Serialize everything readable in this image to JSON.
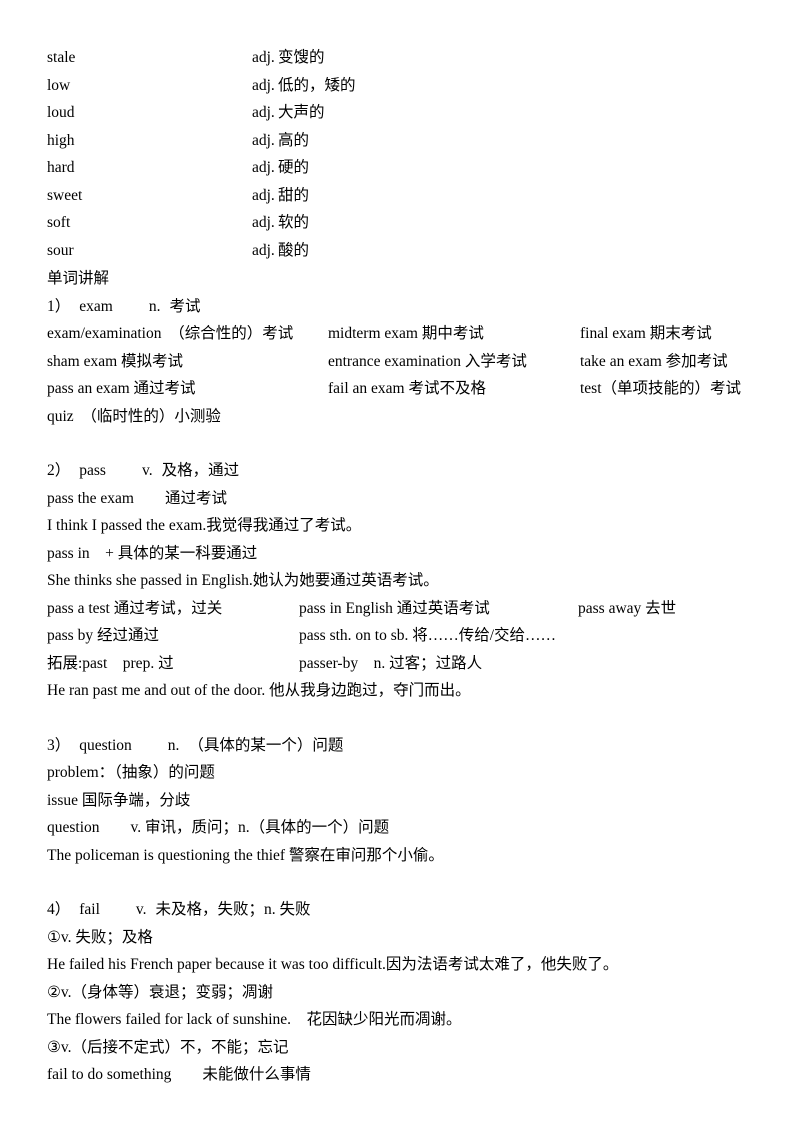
{
  "document": {
    "type": "study-notes",
    "language": "zh-CN/en"
  },
  "vocabulary": {
    "rows": [
      {
        "word": "stale",
        "pos": "adj.",
        "definition": "变馊的"
      },
      {
        "word": "low",
        "pos": "adj.",
        "definition": "低的，矮的"
      },
      {
        "word": "loud",
        "pos": "adj.",
        "definition": "大声的"
      },
      {
        "word": "high",
        "pos": "adj.",
        "definition": "高的"
      },
      {
        "word": "hard",
        "pos": "adj.",
        "definition": "硬的"
      },
      {
        "word": "sweet",
        "pos": "adj.",
        "definition": "甜的"
      },
      {
        "word": "soft",
        "pos": "adj.",
        "definition": "软的"
      },
      {
        "word": "sour",
        "pos": "adj.",
        "definition": "酸的"
      }
    ]
  },
  "section_title": "单词讲解",
  "entries": {
    "exam": {
      "heading_number": "1）",
      "heading_word": "exam",
      "heading_pos": "n.",
      "heading_def": "考试",
      "phrase_rows": [
        {
          "col1": "exam/examination　（综合性的）考试",
          "col2": "midterm exam  期中考试",
          "col3": "final exam  期末考试"
        },
        {
          "col1": "sham exam  模拟考试",
          "col2": "entrance examination  入学考试",
          "col3": "take an exam  参加考试"
        },
        {
          "col1": "pass an exam  通过考试",
          "col2": "fail an exam  考试不及格",
          "col3": "test（单项技能的）考试"
        }
      ],
      "tail_line": "quiz　（临时性的）小测验"
    },
    "pass": {
      "heading_number": "2）",
      "heading_word": "pass",
      "heading_pos": "v.",
      "heading_def": "及格，通过",
      "lines": [
        "pass the exam　　通过考试",
        "I think I passed the exam.我觉得我通过了考试。",
        "pass in　+ 具体的某一科要通过",
        "She thinks she passed in English.她认为她要通过英语考试。"
      ],
      "phrase_rows": [
        {
          "col1": "pass a test  通过考试，过关",
          "col2": "pass in English  通过英语考试",
          "col3": "pass away  去世"
        },
        {
          "col1": "pass by  经过通过",
          "col2": "pass sth. on to sb.  将……传给/交给……",
          "col3": ""
        },
        {
          "col1": "拓展:past　prep. 过",
          "col2": "passer-by　n. 过客；过路人",
          "col3": ""
        }
      ],
      "example": "He ran past me and out of the door.  他从我身边跑过，夺门而出。"
    },
    "question": {
      "heading_number": "3）",
      "heading_word": "question",
      "heading_pos": "n.",
      "heading_def": "（具体的某一个）问题",
      "lines": [
        "problem：（抽象）的问题",
        "issue  国际争端，分歧",
        "question　　v. 审讯，质问；n.（具体的一个）问题",
        "The policeman is questioning the thief 警察在审问那个小偷。"
      ]
    },
    "fail": {
      "heading_number": "4）",
      "heading_word": "fail",
      "heading_pos": "v.",
      "heading_def": "未及格，失败；n. 失败",
      "senses": [
        {
          "marker": "①",
          "gloss": "v. 失败；及格",
          "example": "He failed his French paper because it was too difficult.因为法语考试太难了，他失败了。"
        },
        {
          "marker": "②",
          "gloss": "v.（身体等）衰退；变弱；凋谢",
          "example": "The flowers failed for lack of sunshine.　花因缺少阳光而凋谢。"
        },
        {
          "marker": "③",
          "gloss": "v.（后接不定式）不，不能；忘记",
          "example": "fail to do something　　未能做什么事情"
        }
      ]
    }
  }
}
